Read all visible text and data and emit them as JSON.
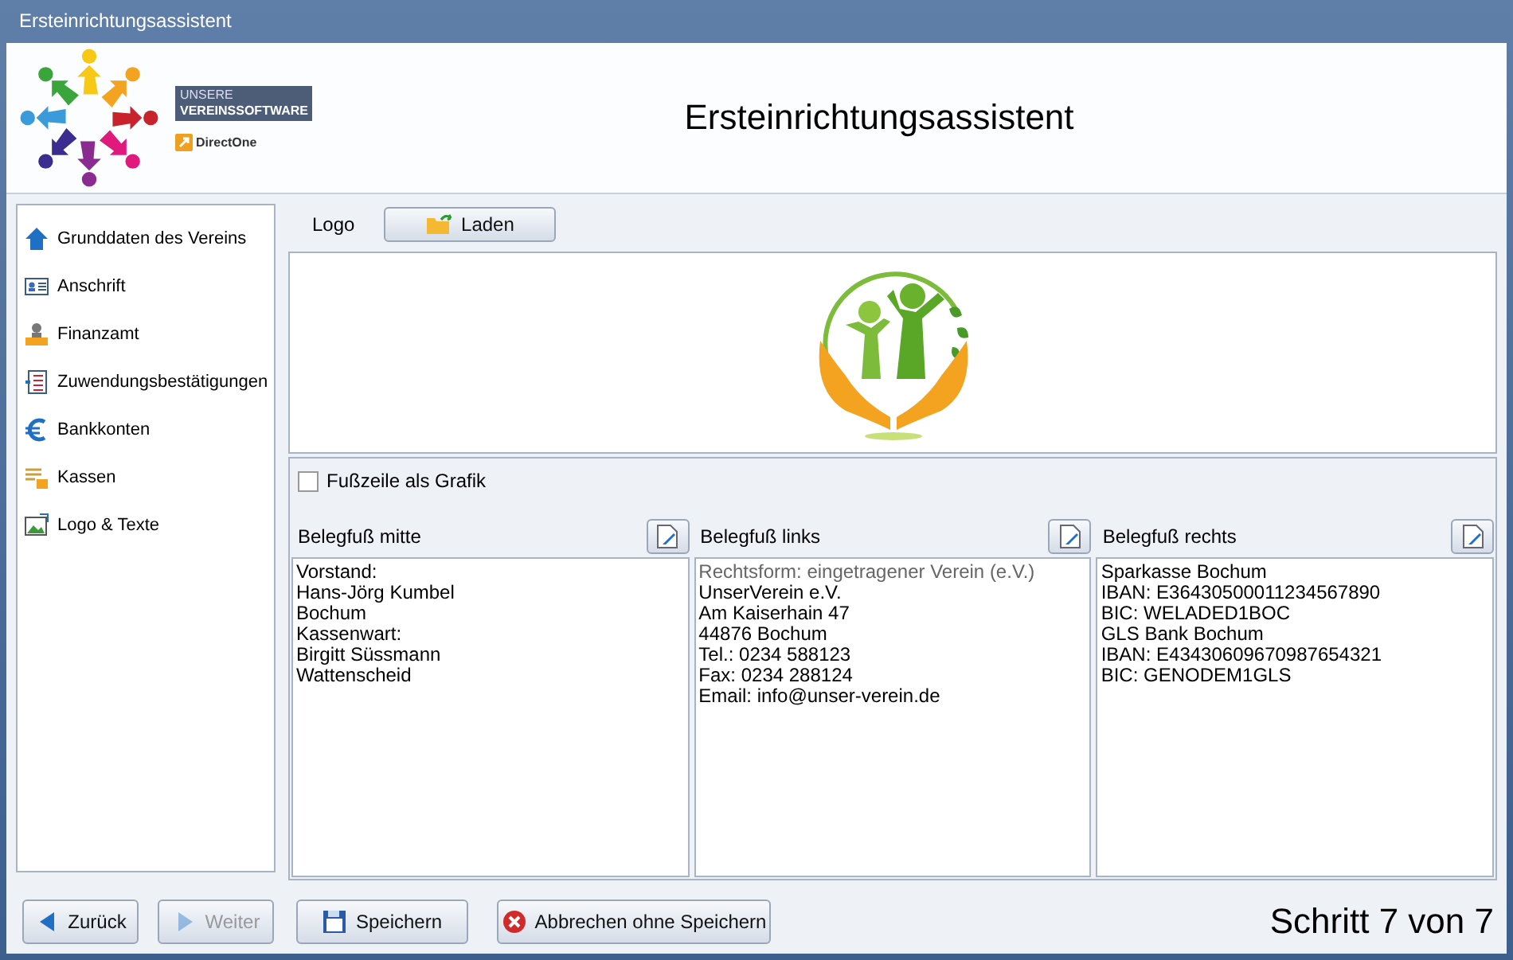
{
  "window": {
    "title": "Ersteinrichtungsassistent"
  },
  "header": {
    "logo_line_1": "UNSERE",
    "logo_line_2": "VEREINSSOFTWARE",
    "vendor": "DirectOne",
    "title": "Ersteinrichtungsassistent"
  },
  "sidebar": {
    "items": [
      {
        "label": "Grunddaten des Vereins",
        "kind": "home"
      },
      {
        "label": "Anschrift",
        "kind": "card"
      },
      {
        "label": "Finanzamt",
        "kind": "person"
      },
      {
        "label": "Zuwendungsbestätigungen",
        "kind": "list"
      },
      {
        "label": "Bankkonten",
        "kind": "euro"
      },
      {
        "label": "Kassen",
        "kind": "register"
      },
      {
        "label": "Logo & Texte",
        "kind": "picture"
      }
    ]
  },
  "logo": {
    "label": "Logo",
    "load_button": "Laden"
  },
  "footer_graphic": {
    "label": "Fußzeile als Grafik",
    "checked": false
  },
  "footers": [
    {
      "label": "Belegfuß mitte",
      "first_line_dimmed": false,
      "lines": [
        "Vorstand:",
        "Hans-Jörg Kumbel",
        "Bochum",
        "Kassenwart:",
        "Birgitt Süssmann",
        "Wattenscheid"
      ]
    },
    {
      "label": "Belegfuß links",
      "first_line_dimmed": true,
      "lines": [
        "Rechtsform: eingetragener Verein (e.V.)",
        "UnserVerein e.V.",
        "Am Kaiserhain 47",
        "44876 Bochum",
        "Tel.: 0234 588123",
        "Fax: 0234 288124",
        "Email: info@unser-verein.de"
      ]
    },
    {
      "label": "Belegfuß rechts",
      "first_line_dimmed": false,
      "lines": [
        "Sparkasse Bochum",
        "IBAN: E36430500011234567890",
        "BIC: WELADED1BOC",
        "GLS Bank Bochum",
        "IBAN: E43430609670987654321",
        "BIC: GENODEM1GLS"
      ]
    }
  ],
  "buttons": [
    {
      "label": "Zurück",
      "kind": "back",
      "disabled": false
    },
    {
      "label": "Weiter",
      "kind": "next",
      "disabled": true
    },
    {
      "label": "Speichern",
      "kind": "save",
      "disabled": false
    },
    {
      "label": "Abbrechen ohne Speichern",
      "kind": "cancel",
      "disabled": false
    }
  ],
  "step": "Schritt 7 von 7"
}
